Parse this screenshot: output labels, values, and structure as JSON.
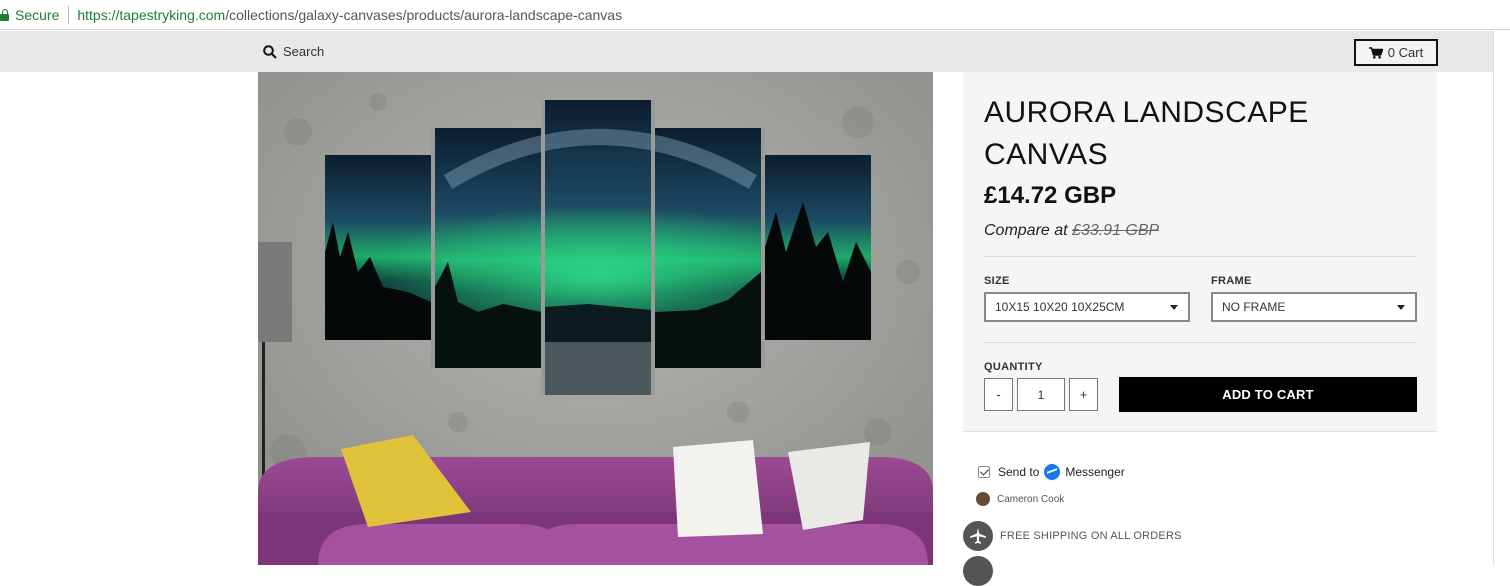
{
  "browser": {
    "secure_label": "Secure",
    "url_host": "https://tapestryking.com",
    "url_path": "/collections/galaxy-canvases/products/aurora-landscape-canvas"
  },
  "header": {
    "search_label": "Search",
    "cart_label": "0 Cart"
  },
  "product": {
    "title_line1": "AURORA LANDSCAPE",
    "title_line2": "CANVAS",
    "price": "£14.72 GBP",
    "compare_prefix": "Compare at",
    "compare_price": "£33.91 GBP",
    "size": {
      "label": "SIZE",
      "selected": "10X15 10X20 10X25CM"
    },
    "frame": {
      "label": "FRAME",
      "selected": "NO FRAME"
    },
    "quantity": {
      "label": "QUANTITY",
      "value": "1",
      "minus": "-",
      "plus": "+"
    },
    "add_to_cart_label": "ADD TO CART"
  },
  "messenger": {
    "send_label": "Send to",
    "messenger_label": "Messenger",
    "user_name": "Cameron Cook"
  },
  "shipping": {
    "label": "FREE SHIPPING ON ALL ORDERS"
  },
  "colors": {
    "brand_button": "#000000",
    "secure_green": "#1e7e34",
    "sofa": "#8a3f84",
    "aurora": "#22c27a"
  }
}
